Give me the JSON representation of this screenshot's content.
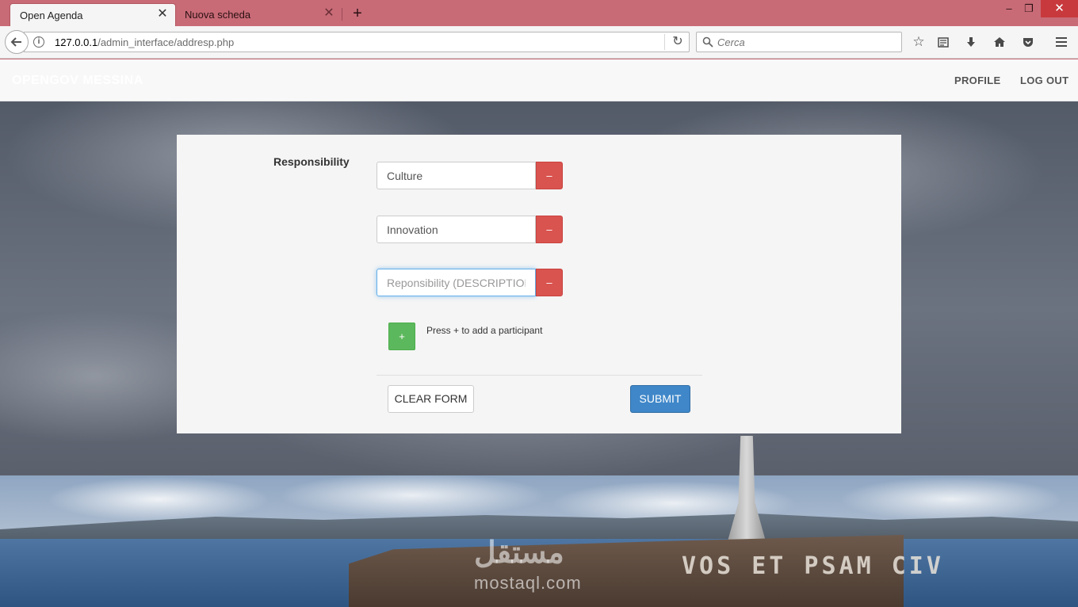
{
  "browser": {
    "tabs": [
      {
        "label": "Open Agenda",
        "active": true
      },
      {
        "label": "Nuova scheda",
        "active": false
      }
    ],
    "new_tab_glyph": "+",
    "url_host": "127.0.0.1",
    "url_path": "/admin_interface/addresp.php",
    "search_placeholder": "Cerca",
    "window_controls": {
      "minimize": "–",
      "maximize": "❐",
      "close": "✕"
    },
    "toolbar_icons": [
      "star-icon",
      "reader-list-icon",
      "download-icon",
      "home-icon",
      "pocket-icon",
      "menu-icon"
    ]
  },
  "navbar": {
    "brand": "OPENGOV MESSINA",
    "links": {
      "profile": "PROFILE",
      "logout": "LOG OUT"
    }
  },
  "form": {
    "label": "Responsibility",
    "fields": [
      {
        "value": "Culture",
        "placeholder": ""
      },
      {
        "value": "Innovation",
        "placeholder": ""
      },
      {
        "value": "",
        "placeholder": "Reponsibility (DESCRIPTION)"
      }
    ],
    "remove_glyph": "–",
    "add_glyph": "+",
    "add_hint": "Press + to add a participant",
    "clear_label": "CLEAR FORM",
    "submit_label": "SUBMIT"
  },
  "background": {
    "fortress_inscription": "VOS ET PSAM CIV",
    "watermark_arabic": "مستقل",
    "watermark_latin": "mostaql.com"
  },
  "colors": {
    "tabstrip": "#c86b77",
    "remove_button": "#d9534f",
    "add_button": "#5cb85c",
    "submit_button": "#3f87c9"
  }
}
